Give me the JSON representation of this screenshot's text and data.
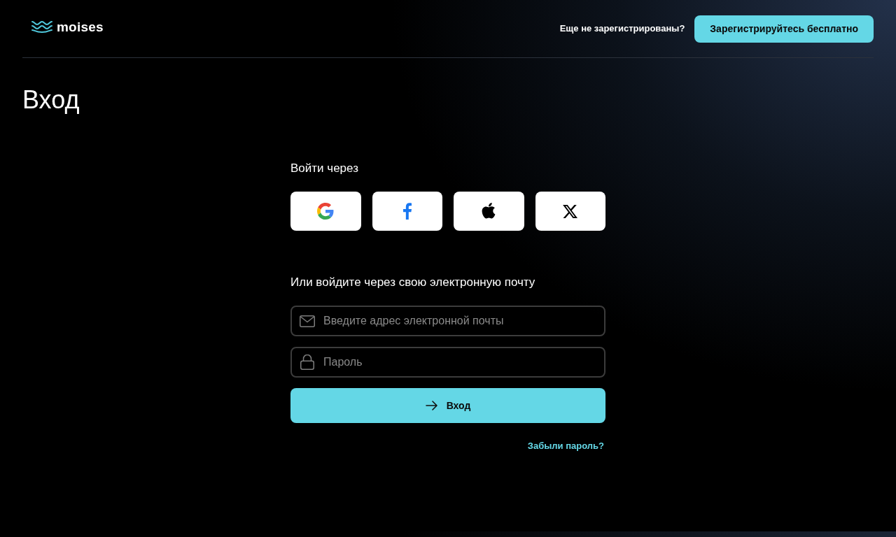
{
  "header": {
    "logo": {
      "text": "moises"
    },
    "prompt": "Еще не зарегистрированы?",
    "signup_button": "Зарегистрируйтесь бесплатно"
  },
  "title": "Вход",
  "social": {
    "heading": "Войти через",
    "providers": [
      {
        "kind": "google"
      },
      {
        "kind": "facebook"
      },
      {
        "kind": "apple"
      },
      {
        "kind": "x"
      }
    ]
  },
  "email_login": {
    "heading": "Или войдите через свою электронную почту",
    "fields": [
      {
        "kind": "email",
        "placeholder": "Введите адрес электронной почты"
      },
      {
        "kind": "password",
        "placeholder": "Пароль"
      }
    ],
    "submit_button": "Вход",
    "forgot_link": "Забыли пароль?"
  }
}
